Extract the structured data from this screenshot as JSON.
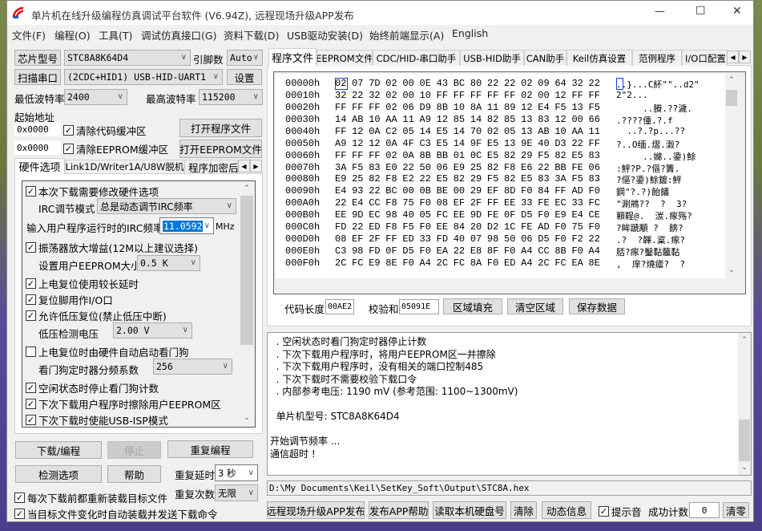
{
  "window": {
    "title": "单片机在线升级编程仿真调试平台软件 (V6.94Z), 远程现场升级APP发布",
    "minimize": "—",
    "maximize": "☐",
    "close": "✕"
  },
  "menu": [
    "文件(F)",
    "编程(O)",
    "工具(T)",
    "调试仿真接口(G)",
    "资料下载(D)",
    "USB驱动安装(D)",
    "始终前端显示(A)",
    "English"
  ],
  "left": {
    "chip_button": "芯片型号",
    "chip_value": "STC8A8K64D4",
    "pins_label": "引脚数",
    "pins_value": "Auto",
    "scan_button": "扫描串口",
    "port_value": "(2CDC+HID1) USB-HID-UART1",
    "settings_button": "设置",
    "min_baud_label": "最低波特率",
    "min_baud_value": "2400",
    "max_baud_label": "最高波特率",
    "max_baud_value": "115200",
    "start_addr_label": "起始地址",
    "code_addr": "0x0000",
    "clear_code_label": "清除代码缓冲区",
    "open_program_button": "打开程序文件",
    "eeprom_addr": "0x0000",
    "clear_eeprom_label": "清除EEPROM缓冲区",
    "open_eeprom_button": "打开EEPROM文件",
    "tabs": [
      "硬件选项",
      "Link1D/Writer1A/U8W脱机",
      "程序加密后"
    ],
    "options": {
      "modify_hw": "本次下载需要修改硬件选项",
      "irc_mode_label": "IRC调节模式",
      "irc_mode_value": "总是动态调节IRC频率",
      "irc_freq_label": "输入用户程序运行时的IRC频率",
      "irc_freq_value": "11.0592",
      "irc_freq_unit": "MHz",
      "osc_gain": "振荡器放大增益(12M以上建议选择)",
      "eeprom_size_label": "设置用户EEPROM大小",
      "eeprom_size_value": "0.5 K",
      "long_delay": "上电复位使用较长延时",
      "reset_io": "复位脚用作I/O口",
      "lvr": "允许低压复位(禁止低压中断)",
      "lvd_label": "低压检测电压",
      "lvd_value": "2.00 V",
      "wdt_auto": "上电复位时由硬件自动启动看门狗",
      "wdt_div_label": "看门狗定时器分频系数",
      "wdt_div_value": "256",
      "wdt_idle": "空闲状态时停止看门狗计数",
      "erase_eeprom": "下次下载用户程序时擦除用户EEPROM区",
      "usb_isp": "下次下载时使能USB-ISP模式"
    },
    "download_button": "下载/编程",
    "stop_button": "停止",
    "repeat_button": "重复编程",
    "check_button": "检测选项",
    "help_button": "帮助",
    "repeat_delay_label": "重复延时",
    "repeat_delay_value": "3 秒",
    "repeat_count_label": "重复次数",
    "repeat_count_value": "无限",
    "reload_label": "每次下载前都重新装载目标文件",
    "auto_load_label": "当目标文件变化时自动装载并发送下载命令"
  },
  "right": {
    "tabs": [
      "程序文件",
      "EEPROM文件",
      "CDC/HID-串口助手",
      "USB-HID助手",
      "CAN助手",
      "Keil仿真设置",
      "范例程序",
      "I/O口配置"
    ],
    "hex_rows": [
      {
        "addr": "00000h",
        "bytes": "02 07 7D 02 00 0E 43 BC 80 22 22 02 09 64 32 22",
        "ascii": "..}...C紑\"\"..d2\""
      },
      {
        "addr": "00010h",
        "bytes": "32 22 32 02 00 10 FF FF FF FF FF 02 00 12 FF FF",
        "ascii": "2\"2..."
      },
      {
        "addr": "00020h",
        "bytes": "FF FF FF 02 06 D9 8B 10 8A 11 89 12 E4 F5 13 F5",
        "ascii": "     ..賸.??濊."
      },
      {
        "addr": "00030h",
        "bytes": "14 AB 10 AA 11 A9 12 85 14 82 85 13 83 12 00 66",
        "ascii": ".????偅.?.f"
      },
      {
        "addr": "00040h",
        "bytes": "FF 12 0A C2 05 14 E5 14 70 02 05 13 AB 10 AA 11",
        "ascii": "  ..?.?p...??"
      },
      {
        "addr": "00050h",
        "bytes": "A9 12 12 0A 4F C3 E5 14 9F E5 13 9E 40 D3 22 FF",
        "ascii": "?..O缅.熠.瀫?"
      },
      {
        "addr": "00060h",
        "bytes": "FF FF FF 02 0A 8B BB 01 0C E5 82 29 F5 82 E5 83",
        "ascii": "     ..嬵..鍌)鮽"
      },
      {
        "addr": "00070h",
        "bytes": "3A F5 83 E0 22 50 06 E9 25 82 F8 E6 22 BB FE 06",
        "ascii": ":鮃?P.?傴?簀."
      },
      {
        "addr": "00080h",
        "bytes": "E9 25 82 F8 E2 22 E5 82 29 F5 82 E5 83 3A F5 83",
        "ascii": "?傴?鍌)鮽鍍:鮃"
      },
      {
        "addr": "00090h",
        "bytes": "E4 93 22 BC 00 0B BE 00 29 EF 8D F0 84 FF AD F0",
        "ascii": "鋼\"?.?)飴鐇"
      },
      {
        "addr": "000A0h",
        "bytes": "22 E4 CC F8 75 F0 08 EF 2F FF EE 33 FE EC 33 FC",
        "ascii": "\"涮鴘??  ?  3?"
      },
      {
        "addr": "000B0h",
        "bytes": "EE 9D EC 98 40 05 FC EE 9D FE 0F D5 F0 E9 E4 CE",
        "ascii": "顐鞓@.  湠.瘃殇?"
      },
      {
        "addr": "000C0h",
        "bytes": "FD 22 ED F8 F5 F0 EE 84 20 D2 1C FE AD F0 75 F0",
        "ascii": "?眸蹏顒 ?  餴?"
      },
      {
        "addr": "000D0h",
        "bytes": "08 EF 2F FF ED 33 FD 40 07 98 50 06 D5 F0 F2 22",
        "ascii": ".?  ?韗.楶.瘃?"
      },
      {
        "addr": "000E0h",
        "bytes": "C3 98 FD 0F D5 F0 EA 22 E8 8F F0 A4 CC 8B F0 A4",
        "ascii": "脴?瘃?鑿黏虌黏"
      },
      {
        "addr": "000F0h",
        "bytes": "2C FC E9 8E F0 A4 2C FC 8A F0 ED A4 2C FC EA 8E",
        "ascii": ",  庠?燒瘧?  ?"
      }
    ],
    "code_len_label": "代码长度",
    "code_len_value": "00AE2",
    "checksum_label": "校验和",
    "checksum_value": "05091E",
    "fill_button": "区域填充",
    "clear_area_button": "清空区域",
    "save_button": "保存数据",
    "log": [
      "  . 空闲状态时看门狗定时器停止计数",
      "  . 下次下载用户程序时，将用户EEPROM区一并擦除",
      "  . 下次下载用户程序时，没有相关的端口控制485",
      "  . 下次下载时不需要校验下载口令",
      "  . 内部参考电压: 1190 mV (参考范围: 1100~1300mV)",
      "",
      "  单片机型号: STC8A8K64D4",
      "",
      "开始调节频率 ...",
      "通信超时 !"
    ],
    "file_path": "D:\\My Documents\\Keil\\SetKey_Soft\\Output\\STC8A.hex",
    "publish_button": "远程现场升级APP发布",
    "publish_help_button": "发布APP帮助",
    "read_disk_button": "读取本机硬盘号",
    "clear_button": "清除",
    "dynamic_button": "动态信息",
    "beep_label": "提示音",
    "success_label": "成功计数",
    "success_value": "0",
    "reset_button": "清零"
  }
}
